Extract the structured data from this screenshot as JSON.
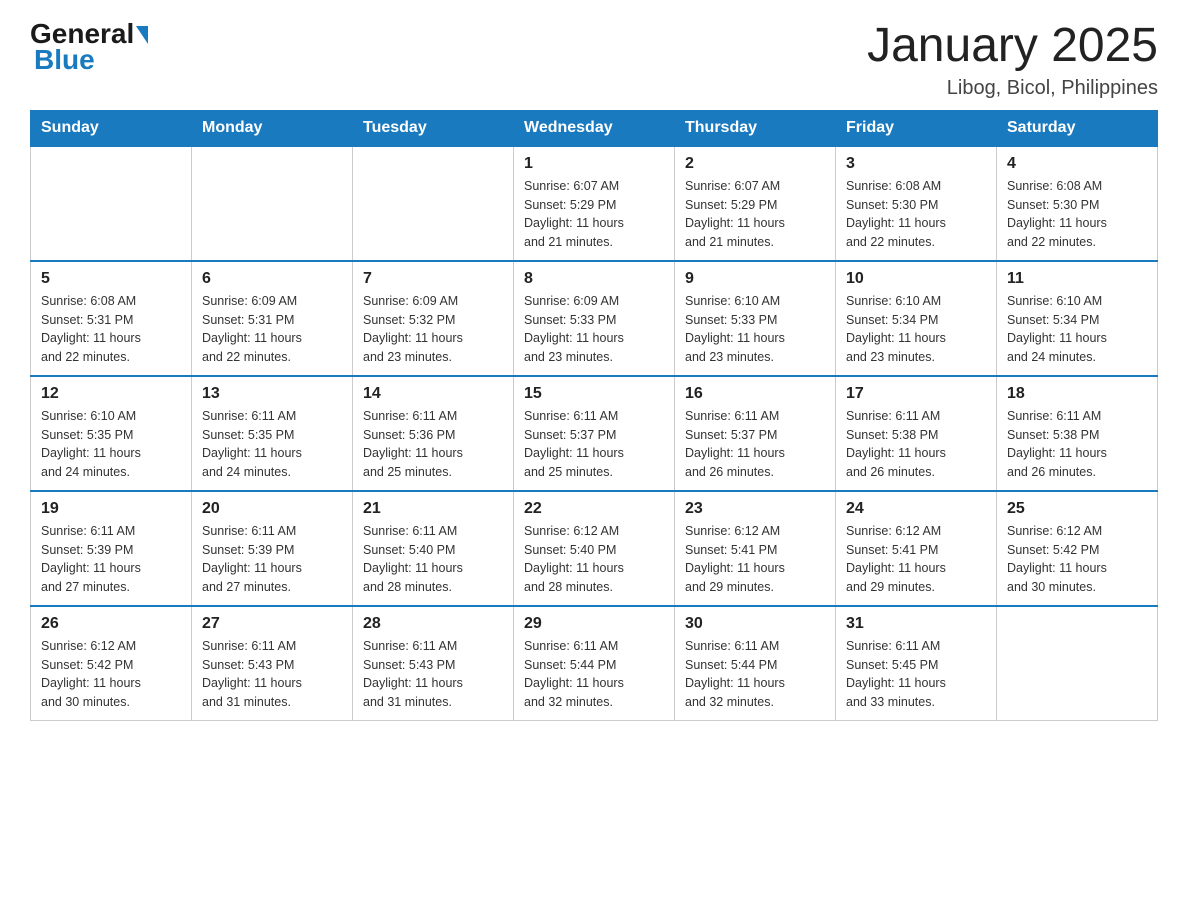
{
  "header": {
    "logo_general": "General",
    "logo_blue": "Blue",
    "title": "January 2025",
    "subtitle": "Libog, Bicol, Philippines"
  },
  "weekdays": [
    "Sunday",
    "Monday",
    "Tuesday",
    "Wednesday",
    "Thursday",
    "Friday",
    "Saturday"
  ],
  "weeks": [
    [
      {
        "day": "",
        "info": ""
      },
      {
        "day": "",
        "info": ""
      },
      {
        "day": "",
        "info": ""
      },
      {
        "day": "1",
        "info": "Sunrise: 6:07 AM\nSunset: 5:29 PM\nDaylight: 11 hours\nand 21 minutes."
      },
      {
        "day": "2",
        "info": "Sunrise: 6:07 AM\nSunset: 5:29 PM\nDaylight: 11 hours\nand 21 minutes."
      },
      {
        "day": "3",
        "info": "Sunrise: 6:08 AM\nSunset: 5:30 PM\nDaylight: 11 hours\nand 22 minutes."
      },
      {
        "day": "4",
        "info": "Sunrise: 6:08 AM\nSunset: 5:30 PM\nDaylight: 11 hours\nand 22 minutes."
      }
    ],
    [
      {
        "day": "5",
        "info": "Sunrise: 6:08 AM\nSunset: 5:31 PM\nDaylight: 11 hours\nand 22 minutes."
      },
      {
        "day": "6",
        "info": "Sunrise: 6:09 AM\nSunset: 5:31 PM\nDaylight: 11 hours\nand 22 minutes."
      },
      {
        "day": "7",
        "info": "Sunrise: 6:09 AM\nSunset: 5:32 PM\nDaylight: 11 hours\nand 23 minutes."
      },
      {
        "day": "8",
        "info": "Sunrise: 6:09 AM\nSunset: 5:33 PM\nDaylight: 11 hours\nand 23 minutes."
      },
      {
        "day": "9",
        "info": "Sunrise: 6:10 AM\nSunset: 5:33 PM\nDaylight: 11 hours\nand 23 minutes."
      },
      {
        "day": "10",
        "info": "Sunrise: 6:10 AM\nSunset: 5:34 PM\nDaylight: 11 hours\nand 23 minutes."
      },
      {
        "day": "11",
        "info": "Sunrise: 6:10 AM\nSunset: 5:34 PM\nDaylight: 11 hours\nand 24 minutes."
      }
    ],
    [
      {
        "day": "12",
        "info": "Sunrise: 6:10 AM\nSunset: 5:35 PM\nDaylight: 11 hours\nand 24 minutes."
      },
      {
        "day": "13",
        "info": "Sunrise: 6:11 AM\nSunset: 5:35 PM\nDaylight: 11 hours\nand 24 minutes."
      },
      {
        "day": "14",
        "info": "Sunrise: 6:11 AM\nSunset: 5:36 PM\nDaylight: 11 hours\nand 25 minutes."
      },
      {
        "day": "15",
        "info": "Sunrise: 6:11 AM\nSunset: 5:37 PM\nDaylight: 11 hours\nand 25 minutes."
      },
      {
        "day": "16",
        "info": "Sunrise: 6:11 AM\nSunset: 5:37 PM\nDaylight: 11 hours\nand 26 minutes."
      },
      {
        "day": "17",
        "info": "Sunrise: 6:11 AM\nSunset: 5:38 PM\nDaylight: 11 hours\nand 26 minutes."
      },
      {
        "day": "18",
        "info": "Sunrise: 6:11 AM\nSunset: 5:38 PM\nDaylight: 11 hours\nand 26 minutes."
      }
    ],
    [
      {
        "day": "19",
        "info": "Sunrise: 6:11 AM\nSunset: 5:39 PM\nDaylight: 11 hours\nand 27 minutes."
      },
      {
        "day": "20",
        "info": "Sunrise: 6:11 AM\nSunset: 5:39 PM\nDaylight: 11 hours\nand 27 minutes."
      },
      {
        "day": "21",
        "info": "Sunrise: 6:11 AM\nSunset: 5:40 PM\nDaylight: 11 hours\nand 28 minutes."
      },
      {
        "day": "22",
        "info": "Sunrise: 6:12 AM\nSunset: 5:40 PM\nDaylight: 11 hours\nand 28 minutes."
      },
      {
        "day": "23",
        "info": "Sunrise: 6:12 AM\nSunset: 5:41 PM\nDaylight: 11 hours\nand 29 minutes."
      },
      {
        "day": "24",
        "info": "Sunrise: 6:12 AM\nSunset: 5:41 PM\nDaylight: 11 hours\nand 29 minutes."
      },
      {
        "day": "25",
        "info": "Sunrise: 6:12 AM\nSunset: 5:42 PM\nDaylight: 11 hours\nand 30 minutes."
      }
    ],
    [
      {
        "day": "26",
        "info": "Sunrise: 6:12 AM\nSunset: 5:42 PM\nDaylight: 11 hours\nand 30 minutes."
      },
      {
        "day": "27",
        "info": "Sunrise: 6:11 AM\nSunset: 5:43 PM\nDaylight: 11 hours\nand 31 minutes."
      },
      {
        "day": "28",
        "info": "Sunrise: 6:11 AM\nSunset: 5:43 PM\nDaylight: 11 hours\nand 31 minutes."
      },
      {
        "day": "29",
        "info": "Sunrise: 6:11 AM\nSunset: 5:44 PM\nDaylight: 11 hours\nand 32 minutes."
      },
      {
        "day": "30",
        "info": "Sunrise: 6:11 AM\nSunset: 5:44 PM\nDaylight: 11 hours\nand 32 minutes."
      },
      {
        "day": "31",
        "info": "Sunrise: 6:11 AM\nSunset: 5:45 PM\nDaylight: 11 hours\nand 33 minutes."
      },
      {
        "day": "",
        "info": ""
      }
    ]
  ]
}
